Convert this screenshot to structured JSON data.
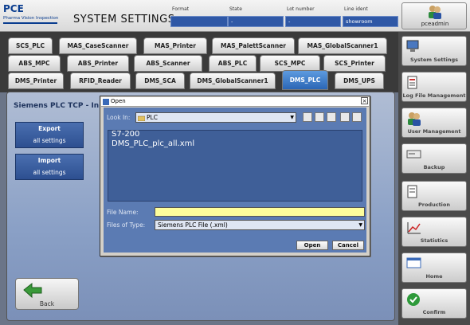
{
  "header": {
    "logo": "PCE",
    "logo_sub": "Pharma Vision Inspection",
    "title": "SYSTEM SETTINGS",
    "fields": [
      {
        "label": "Format",
        "value": ""
      },
      {
        "label": "State",
        "value": "-"
      },
      {
        "label": "Lot number",
        "value": "-"
      },
      {
        "label": "Line ident",
        "value": "showroom"
      }
    ],
    "user": "pceadmin"
  },
  "tabs": {
    "row1": [
      "SCS_PLC",
      "MAS_CaseScanner",
      "MAS_Printer",
      "MAS_PalettScanner",
      "MAS_GlobalScanner1"
    ],
    "row2": [
      "ABS_MPC",
      "ABS_Printer",
      "ABS_Scanner",
      "ABS_PLC",
      "SCS_MPC",
      "SCS_Printer"
    ],
    "row3": [
      "DMS_Printer",
      "RFID_Reader",
      "DMS_SCA",
      "DMS_GlobalScanner1",
      "DMS_PLC",
      "DMS_UPS"
    ],
    "active": "DMS_PLC"
  },
  "main": {
    "title": "Siemens PLC TCP - In",
    "export": {
      "line1": "Export",
      "line2": "all settings"
    },
    "import": {
      "line1": "Import",
      "line2": "all settings"
    },
    "back": "Back"
  },
  "sidebar": [
    {
      "label": "System Settings",
      "icon": "computer-icon"
    },
    {
      "label": "Log File Management",
      "icon": "log-file-icon"
    },
    {
      "label": "User Management",
      "icon": "users-icon"
    },
    {
      "label": "Backup",
      "icon": "backup-drive-icon"
    },
    {
      "label": "Production",
      "icon": "production-icon"
    },
    {
      "label": "Statistics",
      "icon": "statistics-icon"
    },
    {
      "label": "Home",
      "icon": "home-window-icon"
    },
    {
      "label": "Confirm",
      "icon": "confirm-check-icon"
    }
  ],
  "dialog": {
    "title": "Open",
    "look_in_label": "Look In:",
    "look_in_value": "PLC",
    "files": [
      "S7-200",
      "DMS_PLC_plc_all.xml"
    ],
    "file_name_label": "File Name:",
    "file_name_value": "",
    "file_type_label": "Files of Type:",
    "file_type_value": "Siemens PLC File (.xml)",
    "open": "Open",
    "cancel": "Cancel"
  }
}
